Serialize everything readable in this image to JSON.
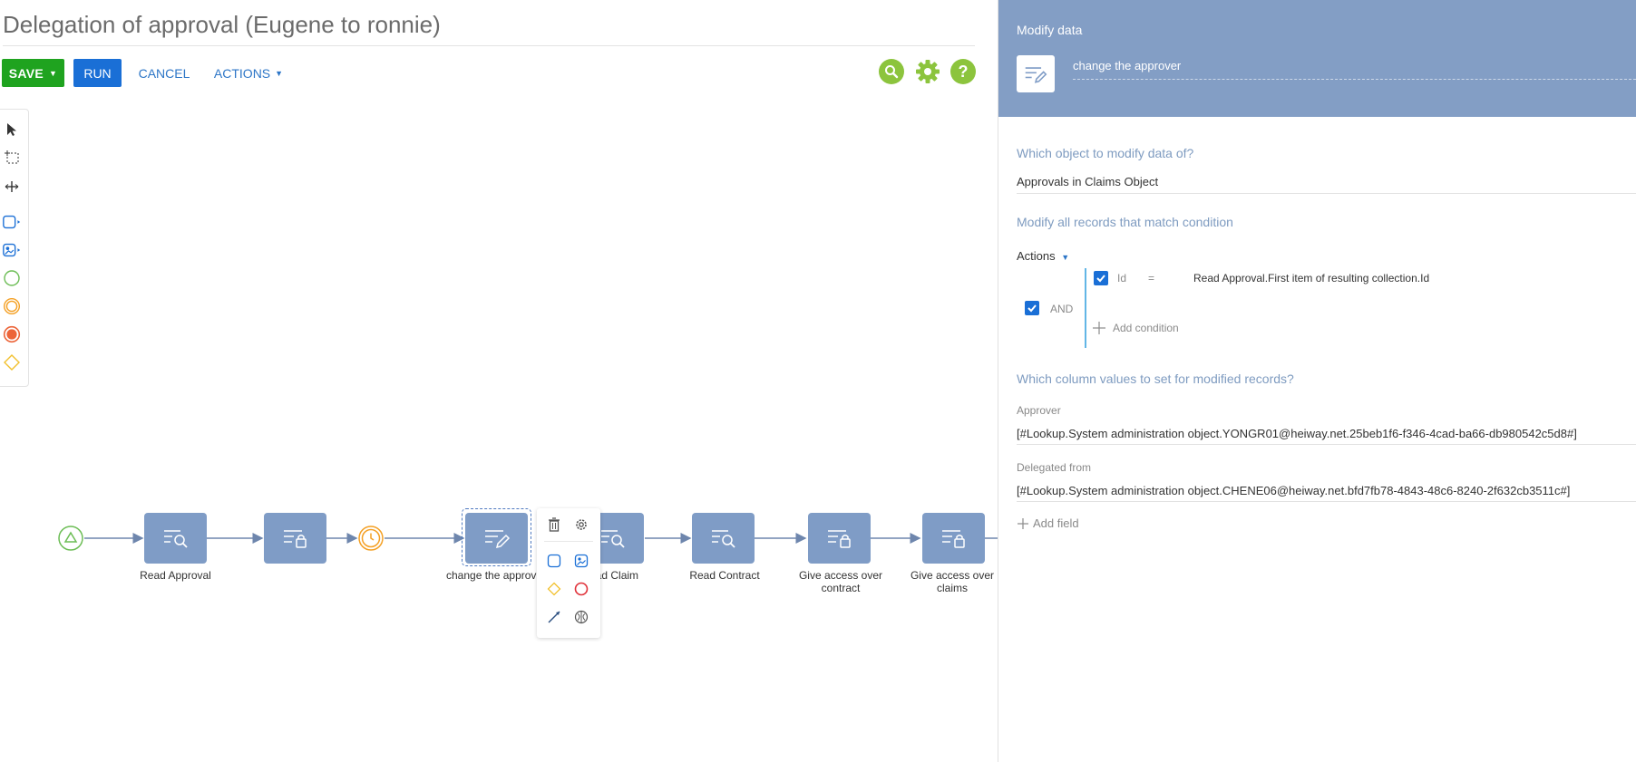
{
  "header": {
    "title": "Delegation of approval (Eugene to ronnie)",
    "save_label": "SAVE",
    "run_label": "RUN",
    "cancel_label": "CANCEL",
    "actions_label": "ACTIONS"
  },
  "colors": {
    "save": "#1fa31f",
    "run": "#1a6fd6",
    "link": "#2d76c7",
    "node": "#7f9cc6",
    "panel_header": "#839ec5",
    "section": "#7e9bc0",
    "top_icons": "#8cc43d"
  },
  "canvas": {
    "nodes": [
      {
        "label": "Read Approval",
        "icon": "read-data-icon"
      },
      {
        "label": "",
        "icon": "access-rights-icon"
      },
      {
        "label": "change the approv",
        "icon": "modify-data-icon"
      },
      {
        "label": "ead Claim",
        "icon": "read-data-icon"
      },
      {
        "label": "Read Contract",
        "icon": "read-data-icon"
      },
      {
        "label": "Give access over\ncontract",
        "icon": "access-rights-icon"
      },
      {
        "label": "Give access over\nclaims",
        "icon": "access-rights-icon"
      }
    ]
  },
  "panel": {
    "title": "Modify data",
    "element_name": "change the approver",
    "object_question": "Which object to modify data of?",
    "object_value": "Approvals in Claims Object",
    "condition_heading": "Modify all records that match condition",
    "actions_label": "Actions",
    "group_operator": "AND",
    "condition": {
      "column": "Id",
      "operator": "=",
      "value": "Read Approval.First item of resulting collection.Id"
    },
    "add_condition": "Add condition",
    "columns_heading": "Which column values to set for modified records?",
    "fields": [
      {
        "label": "Approver",
        "value": "[#Lookup.System administration object.YONGR01@heiway.net.25beb1f6-f346-4cad-ba66-db980542c5d8#]"
      },
      {
        "label": "Delegated from",
        "value": "[#Lookup.System administration object.CHENE06@heiway.net.bfd7fb78-4843-48c6-8240-2f632cb3511c#]"
      }
    ],
    "add_field": "Add field"
  }
}
